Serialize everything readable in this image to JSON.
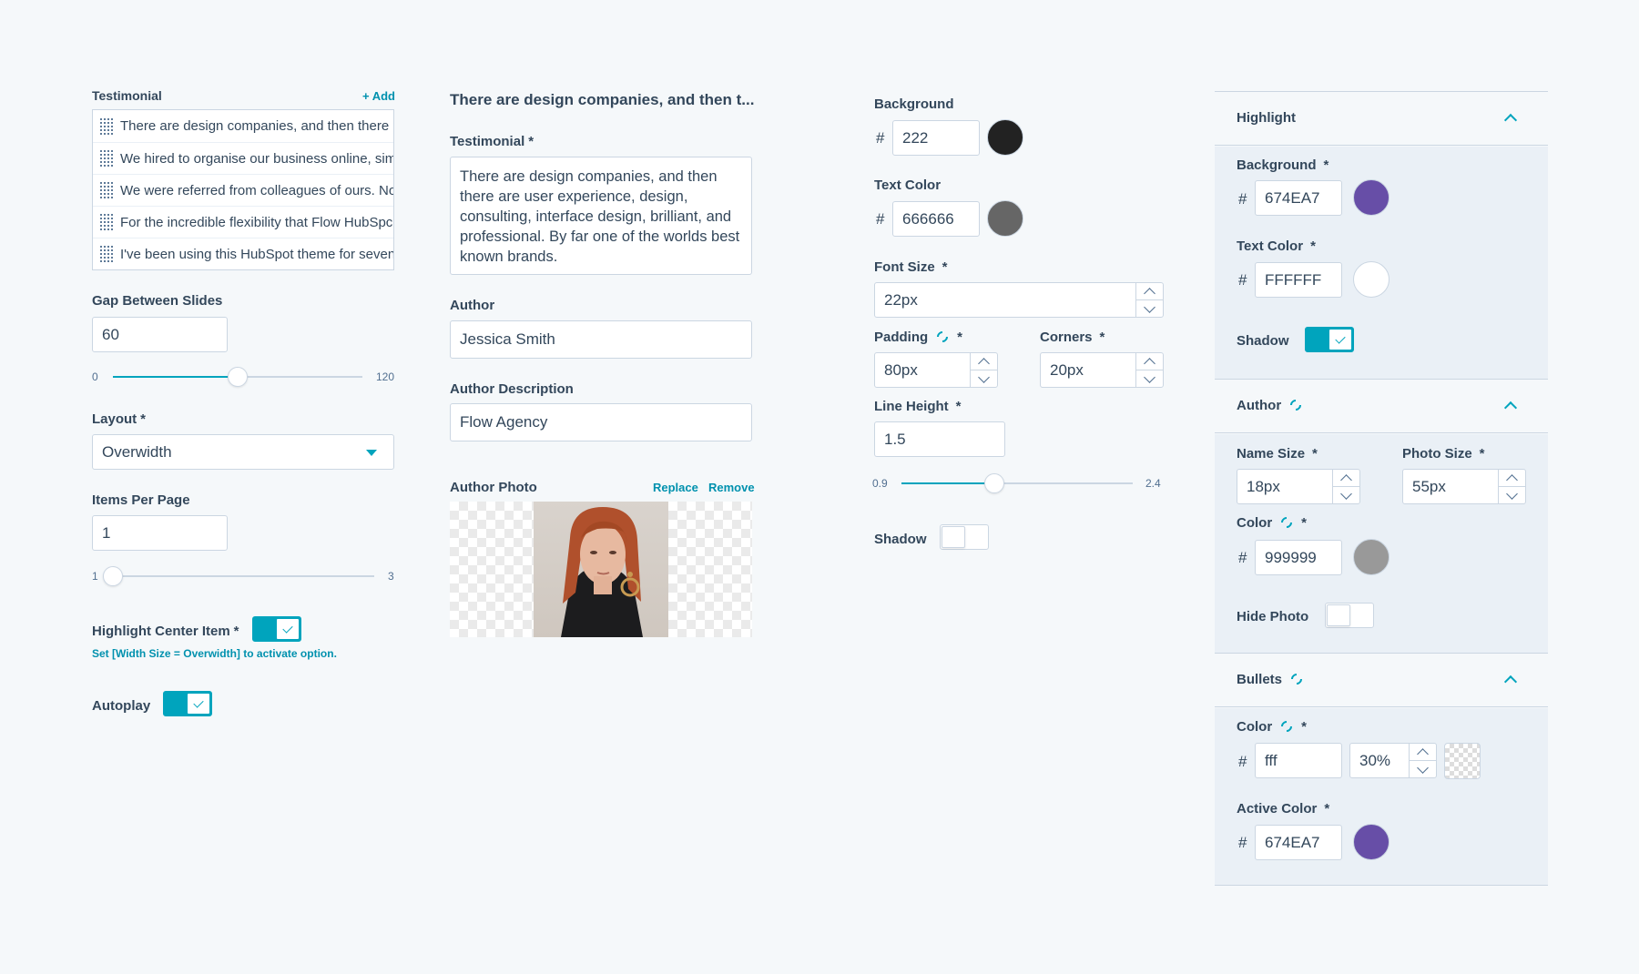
{
  "col1": {
    "testimonial_label": "Testimonial",
    "add_link": "+ Add",
    "testimonials": [
      "There are design companies, and then there c",
      "We hired to organise our business online, simp",
      "We were referred from colleagues of ours. No",
      "For the incredible flexibility that Flow HubSpc",
      "I've been using this HubSpot theme for seven"
    ],
    "gap_label": "Gap Between Slides",
    "gap_value": "60",
    "gap_min": "0",
    "gap_max": "120",
    "gap_fraction": 0.5,
    "layout_label": "Layout",
    "layout_req": "*",
    "layout_value": "Overwidth",
    "items_label": "Items Per Page",
    "items_value": "1",
    "items_min": "1",
    "items_max": "3",
    "items_fraction": 0,
    "highlight_label": "Highlight Center Item",
    "highlight_req": "*",
    "highlight_hint": "Set [Width Size = Overwidth] to activate option.",
    "autoplay_label": "Autoplay"
  },
  "col2": {
    "heading": "There are design companies, and then t...",
    "testimonial_label": "Testimonial",
    "testimonial_req": "*",
    "testimonial_text": "There are design companies, and then there are user experience, design, consulting, interface design, brilliant, and professional. By far one of the worlds best known brands.",
    "author_label": "Author",
    "author_value": "Jessica Smith",
    "desc_label": "Author Description",
    "desc_value": "Flow Agency",
    "photo_label": "Author Photo",
    "replace_link": "Replace",
    "remove_link": "Remove"
  },
  "col3": {
    "bg_label": "Background",
    "bg_value": "222",
    "text_color_label": "Text Color",
    "text_color_value": "666666",
    "font_size_label": "Font Size",
    "font_size_value": "22px",
    "padding_label": "Padding",
    "padding_value": "80px",
    "corners_label": "Corners",
    "corners_value": "20px",
    "line_height_label": "Line Height",
    "line_height_value": "1.5",
    "lh_min": "0.9",
    "lh_max": "2.4",
    "lh_fraction": 0.4,
    "shadow_label": "Shadow",
    "hash": "#",
    "req": "*"
  },
  "panel": {
    "highlight_title": "Highlight",
    "hl_bg_label": "Background",
    "hl_bg_value": "674EA7",
    "hl_text_label": "Text Color",
    "hl_text_value": "FFFFFF",
    "hl_shadow_label": "Shadow",
    "author_title": "Author",
    "name_size_label": "Name Size",
    "name_size_value": "18px",
    "photo_size_label": "Photo Size",
    "photo_size_value": "55px",
    "author_color_label": "Color",
    "author_color_value": "999999",
    "hide_photo_label": "Hide Photo",
    "bullets_title": "Bullets",
    "bullet_color_label": "Color",
    "bullet_color_value": "fff",
    "bullet_opacity_value": "30%",
    "active_color_label": "Active Color",
    "active_color_value": "674EA7"
  },
  "colors": {
    "accent": "#00a4bd",
    "c222": "#222222",
    "c666": "#666666",
    "purple": "#674EA7",
    "white": "#FFFFFF",
    "c999": "#999999"
  }
}
